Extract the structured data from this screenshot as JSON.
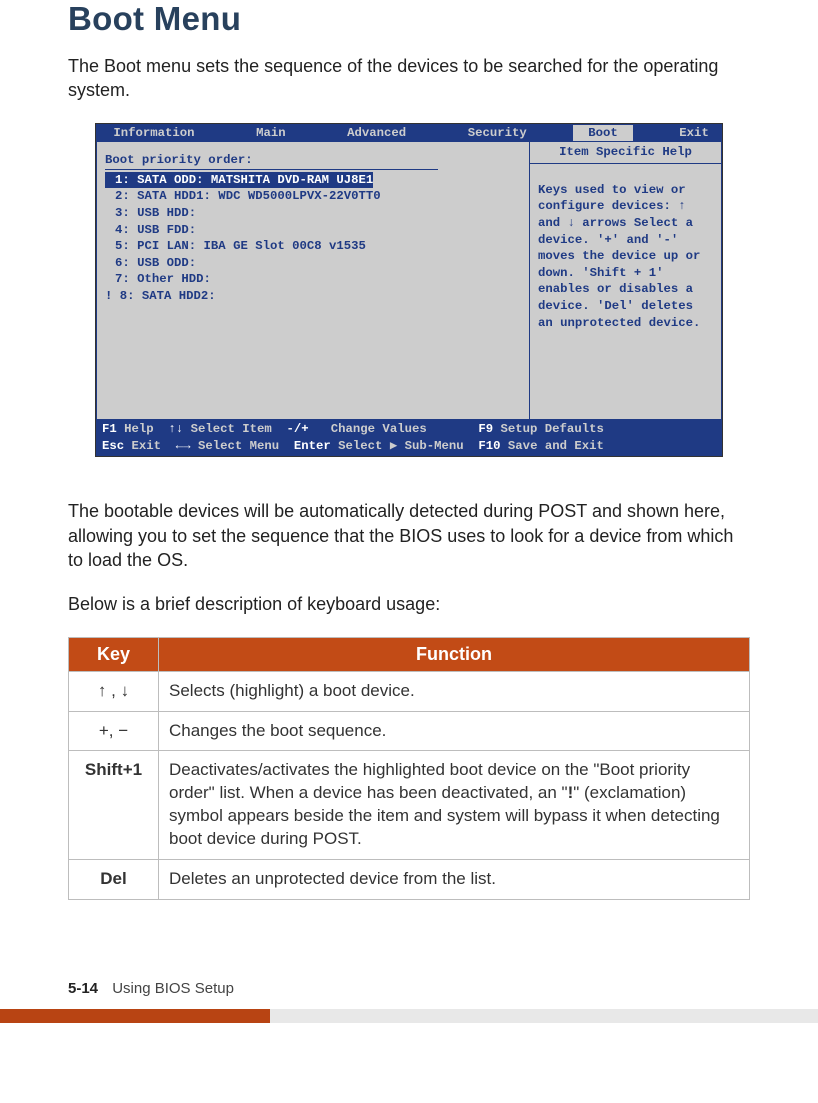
{
  "title": "Boot Menu",
  "intro": "The Boot menu sets the sequence of the devices to be searched for the operating system.",
  "bios": {
    "menubar": {
      "items": [
        "Information",
        "Main",
        "Advanced",
        "Security",
        "Boot",
        "Exit"
      ],
      "active_index": 4
    },
    "left": {
      "heading": "Boot priority order:",
      "rows": [
        {
          "text": "1: SATA ODD: MATSHITA DVD-RAM UJ8E1",
          "state": "selected"
        },
        {
          "text": "2: SATA HDD1: WDC WD5000LPVX-22V0TT0",
          "state": "normal"
        },
        {
          "text": "3: USB HDD:",
          "state": "normal"
        },
        {
          "text": "4: USB FDD:",
          "state": "normal"
        },
        {
          "text": "5: PCI LAN: IBA GE Slot 00C8 v1535",
          "state": "normal"
        },
        {
          "text": "6: USB ODD:",
          "state": "normal"
        },
        {
          "text": "7: Other HDD:",
          "state": "normal"
        },
        {
          "text": "! 8: SATA HDD2:",
          "state": "normal",
          "noindent": true
        }
      ]
    },
    "right": {
      "title": "Item Specific Help",
      "body": "Keys used to view or configure devices: ↑ and ↓ arrows Select a device. '+' and '-' moves the device up or down. 'Shift + 1' enables or disables a device. 'Del' deletes an unprotected device."
    },
    "footer": {
      "line1": {
        "k1": "F1",
        "t1": " Help  ",
        "a1": "↑↓",
        "t2": " Select Item  ",
        "a2": "-/+",
        "t3": "   Change Values       ",
        "k2": "F9",
        "t4": " Setup Defaults"
      },
      "line2": {
        "k1": "Esc",
        "t1": " Exit  ",
        "a1": "←→",
        "t2": " Select Menu  ",
        "a2": "Enter",
        "t3": " Select ▶ Sub-Menu  ",
        "k2": "F10",
        "t4": " Save and Exit "
      }
    }
  },
  "para2": "The bootable devices will be automatically detected during POST and shown here, allowing you to set the sequence that the BIOS uses to look for a device from which to load the OS.",
  "para3": "Below is a brief description of keyboard usage:",
  "table": {
    "head": {
      "c1": "Key",
      "c2": "Function"
    },
    "rows": [
      {
        "key": "↑ , ↓",
        "fn": "Selects (highlight) a boot device."
      },
      {
        "key": "+, −",
        "fn": "Changes the boot sequence."
      },
      {
        "key_html": "<b>Shift+1</b>",
        "fn_html": "Deactivates/activates the highlighted boot device on the \"Boot priority order\" list. When a device has been deactivated, an \"<b>!</b>\" (exclamation) symbol appears beside the item and system will bypass it when detecting boot device during POST."
      },
      {
        "key_html": "<b>Del</b>",
        "fn": "Deletes an unprotected device from the list."
      }
    ]
  },
  "footer": {
    "pagenum": "5-14",
    "section": "Using BIOS Setup"
  }
}
